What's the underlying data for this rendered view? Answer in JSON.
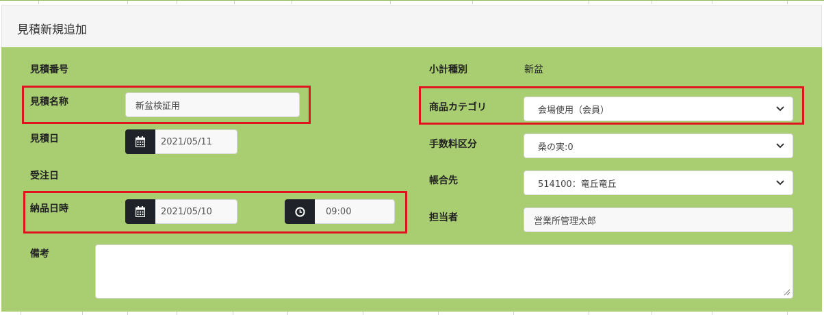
{
  "panel": {
    "title": "見積新規追加"
  },
  "left": {
    "estimate_no_label": "見積番号",
    "estimate_name_label": "見積名称",
    "estimate_name_value": "新盆検証用",
    "estimate_date_label": "見積日",
    "estimate_date_value": "2021/05/11",
    "order_date_label": "受注日",
    "delivery_label": "納品日時",
    "delivery_date_value": "2021/05/10",
    "delivery_time_value": "09:00",
    "remarks_label": "備考",
    "remarks_value": ""
  },
  "right": {
    "subtotal_type_label": "小計種別",
    "subtotal_type_value": "新盆",
    "product_category_label": "商品カテゴリ",
    "product_category_value": "会場使用（会員）",
    "fee_class_label": "手数料区分",
    "fee_class_value": "桑の実:0",
    "account_label": "帳合先",
    "account_value": "514100：竜丘竜丘",
    "person_label": "担当者",
    "person_value": "営業所管理太郎"
  },
  "icons": {
    "calendar": "calendar-icon",
    "clock": "clock-icon",
    "chevron": "chevron-down-icon"
  },
  "colors": {
    "panel_body": "#a9cd71",
    "addon": "#1f2329",
    "highlight": "#e0141e"
  }
}
